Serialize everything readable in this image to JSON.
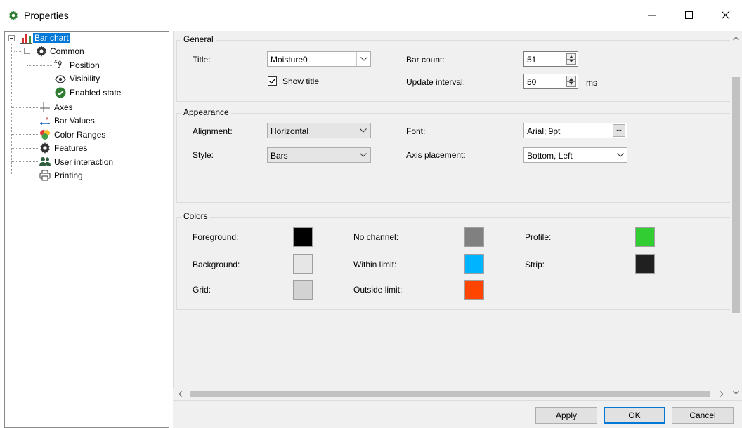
{
  "window": {
    "title": "Properties"
  },
  "tree": {
    "root": "Bar chart",
    "common": "Common",
    "position": "Position",
    "visibility": "Visibility",
    "enabled_state": "Enabled state",
    "axes": "Axes",
    "bar_values": "Bar Values",
    "color_ranges": "Color Ranges",
    "features": "Features",
    "user_interaction": "User interaction",
    "printing": "Printing",
    "position_icon_text": "Xÿ"
  },
  "general": {
    "heading": "General",
    "title_label": "Title:",
    "title_value": "Moisture0",
    "show_title_label": "Show title",
    "show_title_checked": true,
    "bar_count_label": "Bar count:",
    "bar_count_value": "51",
    "update_interval_label": "Update interval:",
    "update_interval_value": "50",
    "update_interval_unit": "ms"
  },
  "appearance": {
    "heading": "Appearance",
    "alignment_label": "Alignment:",
    "alignment_value": "Horizontal",
    "style_label": "Style:",
    "style_value": "Bars",
    "font_label": "Font:",
    "font_value": "Arial; 9pt",
    "font_button": "...",
    "axis_placement_label": "Axis placement:",
    "axis_placement_value": "Bottom, Left"
  },
  "colors": {
    "heading": "Colors",
    "foreground_label": "Foreground:",
    "foreground_color": "#000000",
    "background_label": "Background:",
    "background_color": "#e6e6e6",
    "grid_label": "Grid:",
    "grid_color": "#d3d3d3",
    "no_channel_label": "No channel:",
    "no_channel_color": "#808080",
    "within_limit_label": "Within limit:",
    "within_limit_color": "#00b4ff",
    "outside_limit_label": "Outside limit:",
    "outside_limit_color": "#ff4500",
    "profile_label": "Profile:",
    "profile_color": "#32cd32",
    "strip_label": "Strip:",
    "strip_color": "#202020"
  },
  "buttons": {
    "apply": "Apply",
    "ok": "OK",
    "cancel": "Cancel"
  },
  "accent": "#0078d7"
}
